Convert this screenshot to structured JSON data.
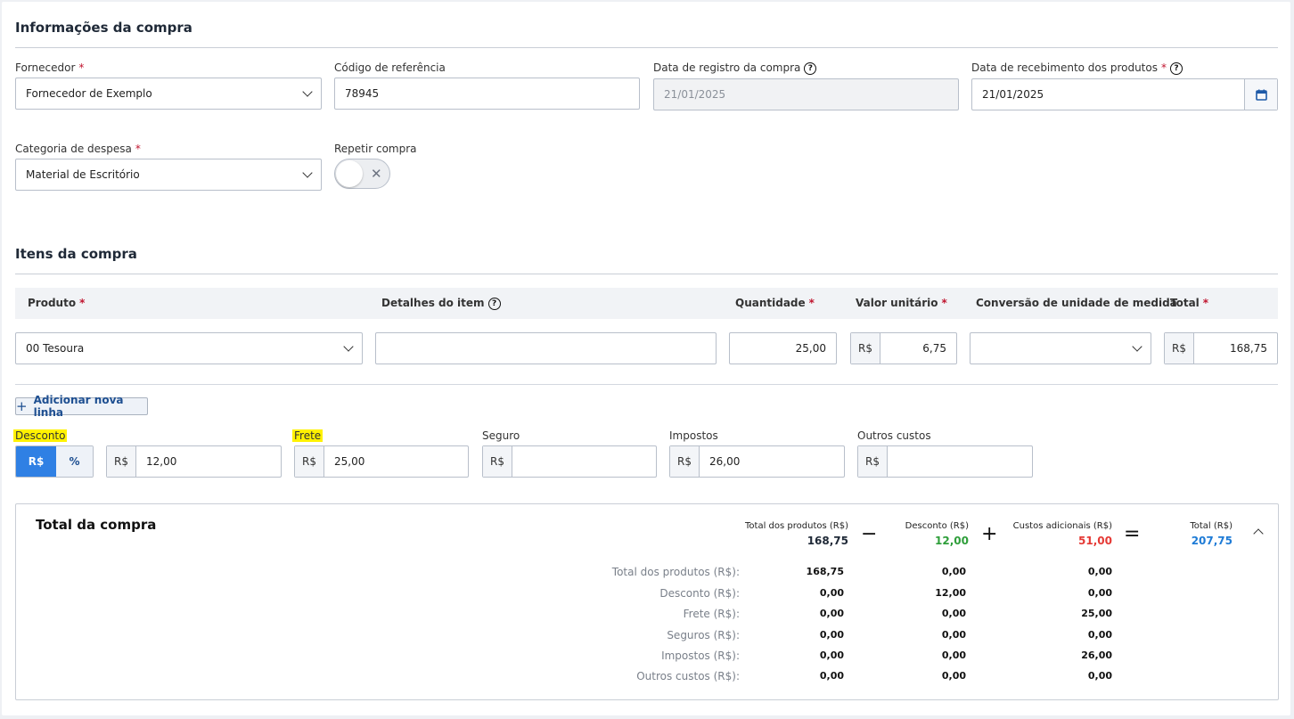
{
  "purchase_info": {
    "title": "Informações da compra",
    "supplier": {
      "label": "Fornecedor",
      "value": "Fornecedor de Exemplo"
    },
    "reference_code": {
      "label": "Código de referência",
      "value": "78945"
    },
    "registration_date": {
      "label": "Data de registro da compra",
      "value": "21/01/2025"
    },
    "receipt_date": {
      "label": "Data de recebimento dos produtos",
      "value": "21/01/2025"
    },
    "expense_category": {
      "label": "Categoria de despesa",
      "value": "Material de Escritório"
    },
    "repeat_purchase": {
      "label": "Repetir compra",
      "enabled": false
    }
  },
  "items": {
    "title": "Itens da compra",
    "columns": {
      "product": "Produto",
      "details": "Detalhes do item",
      "quantity": "Quantidade",
      "unit_value": "Valor unitário",
      "unit_conversion": "Conversão de unidade de medida",
      "total": "Total"
    },
    "rows": [
      {
        "product": "00 Tesoura",
        "details": "",
        "quantity": "25,00",
        "currency": "R$",
        "unit_value": "6,75",
        "conversion": "",
        "total": "168,75"
      }
    ],
    "add_line_label": "Adicionar nova linha"
  },
  "costs": {
    "discount": {
      "label": "Desconto",
      "mode_currency": "R$",
      "mode_percent": "%",
      "prefix": "R$",
      "value": "12,00"
    },
    "freight": {
      "label": "Frete",
      "prefix": "R$",
      "value": "25,00"
    },
    "insurance": {
      "label": "Seguro",
      "prefix": "R$",
      "value": ""
    },
    "taxes": {
      "label": "Impostos",
      "prefix": "R$",
      "value": "26,00"
    },
    "other": {
      "label": "Outros custos",
      "prefix": "R$",
      "value": ""
    }
  },
  "summary": {
    "title": "Total da compra",
    "products_total": {
      "label": "Total dos produtos (R$)",
      "value": "168,75"
    },
    "discount": {
      "label": "Desconto (R$)",
      "value": "12,00"
    },
    "additional": {
      "label": "Custos adicionais (R$)",
      "value": "51,00"
    },
    "total": {
      "label": "Total (R$)",
      "value": "207,75"
    },
    "ops": {
      "minus": "−",
      "plus": "+",
      "equals": "="
    },
    "breakdown": [
      {
        "label": "Total dos produtos (R$):",
        "c1": "168,75",
        "c2": "0,00",
        "c3": "0,00"
      },
      {
        "label": "Desconto (R$):",
        "c1": "0,00",
        "c2": "12,00",
        "c3": "0,00"
      },
      {
        "label": "Frete (R$):",
        "c1": "0,00",
        "c2": "0,00",
        "c3": "25,00"
      },
      {
        "label": "Seguros (R$):",
        "c1": "0,00",
        "c2": "0,00",
        "c3": "0,00"
      },
      {
        "label": "Impostos (R$):",
        "c1": "0,00",
        "c2": "0,00",
        "c3": "26,00"
      },
      {
        "label": "Outros custos (R$):",
        "c1": "0,00",
        "c2": "0,00",
        "c3": "0,00"
      }
    ],
    "colors": {
      "discount": "#2e9e3a",
      "additional": "#e53935",
      "total": "#1e7bd6"
    }
  }
}
